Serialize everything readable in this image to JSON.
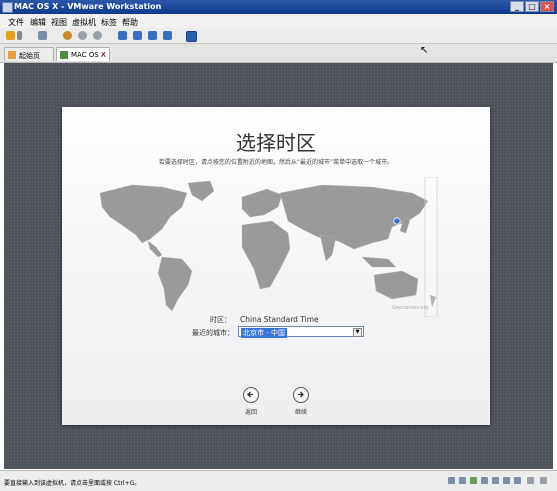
{
  "window": {
    "title": "MAC OS X - VMware Workstation"
  },
  "menu": [
    "文件",
    "编辑",
    "视图",
    "虚拟机",
    "标签",
    "帮助"
  ],
  "tabs": [
    {
      "label": "起始页"
    },
    {
      "label": "MAC OS X"
    }
  ],
  "setup": {
    "title": "选择时区",
    "subtitle": "若要选择时区，请点按您的位置附近的地图，然后从“最近的城市”菜单中选取一个城市。",
    "map_watermark": "Geonames.org",
    "timezone_label": "时区：",
    "timezone_value": "China Standard Time",
    "city_label": "最近的城市：",
    "city_value": "北京市 - 中国",
    "back_label": "返回",
    "continue_label": "继续"
  },
  "status": {
    "text": "要直接输入到该虚拟机，请点击里面或按 Ctrl+G。"
  },
  "colors": {
    "titlebar": "#1a47a0",
    "selection": "#3875d7",
    "vm_background": "#4d5158",
    "map_land": "#9a9a9a"
  }
}
